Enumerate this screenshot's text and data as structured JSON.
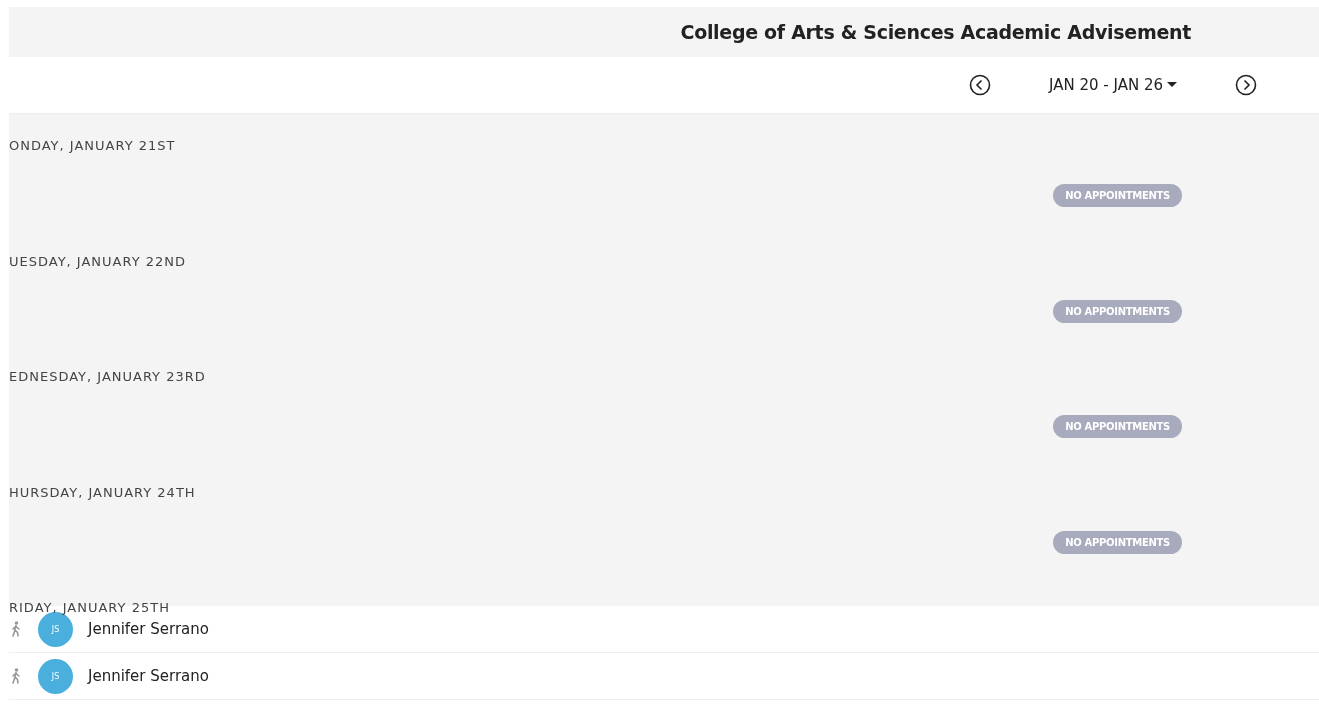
{
  "header": {
    "title": "College of Arts & Sciences Academic Advisement"
  },
  "week_nav": {
    "range": "JAN 20 - JAN 26"
  },
  "days": [
    {
      "label": "ONDAY, JANUARY 21ST",
      "status": "NO APPOINTMENTS"
    },
    {
      "label": "UESDAY, JANUARY 22ND",
      "status": "NO APPOINTMENTS"
    },
    {
      "label": "EDNESDAY, JANUARY 23RD",
      "status": "NO APPOINTMENTS"
    },
    {
      "label": "HURSDAY, JANUARY 24TH",
      "status": "NO APPOINTMENTS"
    },
    {
      "label": "RIDAY, JANUARY 25TH"
    }
  ],
  "appointments": [
    {
      "initials": "JS",
      "name": "Jennifer Serrano"
    },
    {
      "initials": "JS",
      "name": "Jennifer Serrano"
    }
  ]
}
